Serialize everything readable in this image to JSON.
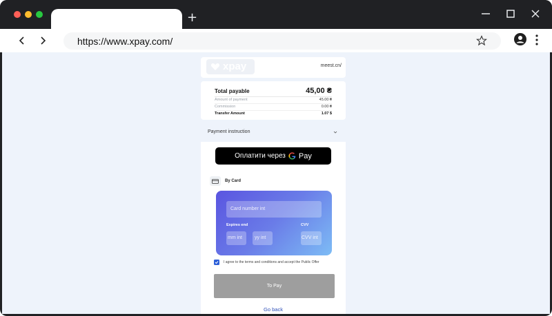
{
  "browser": {
    "new_tab_symbol": "+",
    "url": "https://www.xpay.com/",
    "traffic_colors": [
      "#ff5f57",
      "#febc2e",
      "#28c840"
    ],
    "icons": [
      "back-icon",
      "forward-icon",
      "star-icon",
      "profile-icon",
      "kebab-menu-icon",
      "minimize-icon",
      "maximize-icon",
      "close-icon"
    ]
  },
  "page": {
    "logo_text": "xpay",
    "merchant": "meest.cn/",
    "summary": {
      "total_label": "Total payable",
      "total_value": "45,00 ₴",
      "rows": [
        {
          "label": "Amount of payment",
          "value": "45.00 ₴"
        },
        {
          "label": "Commission",
          "value": "0.00 ₴"
        }
      ],
      "transfer_label": "Transfer Amount",
      "transfer_value": "1.07 $"
    },
    "instruction_label": "Payment instruction",
    "gpay": {
      "text": "Оплатити через",
      "g": "G",
      "pay": "Pay"
    },
    "by_card_label": "By Card",
    "card": {
      "number_placeholder": "Card number int",
      "expires_label": "Expires end",
      "mm_placeholder": "mm int",
      "yy_placeholder": "yy int",
      "cvv_label": "CVV",
      "cvv_placeholder": "CVV int"
    },
    "agree_checked": true,
    "agree_text": "I agree to the terms and conditions and accept the Public Offer",
    "pay_button": "To Pay",
    "go_back": "Go back",
    "colors": {
      "accent": "#2d5fd8",
      "card_start": "#5a55e0",
      "card_end": "#7dbcf5",
      "pay_disabled": "#9e9e9e"
    }
  }
}
